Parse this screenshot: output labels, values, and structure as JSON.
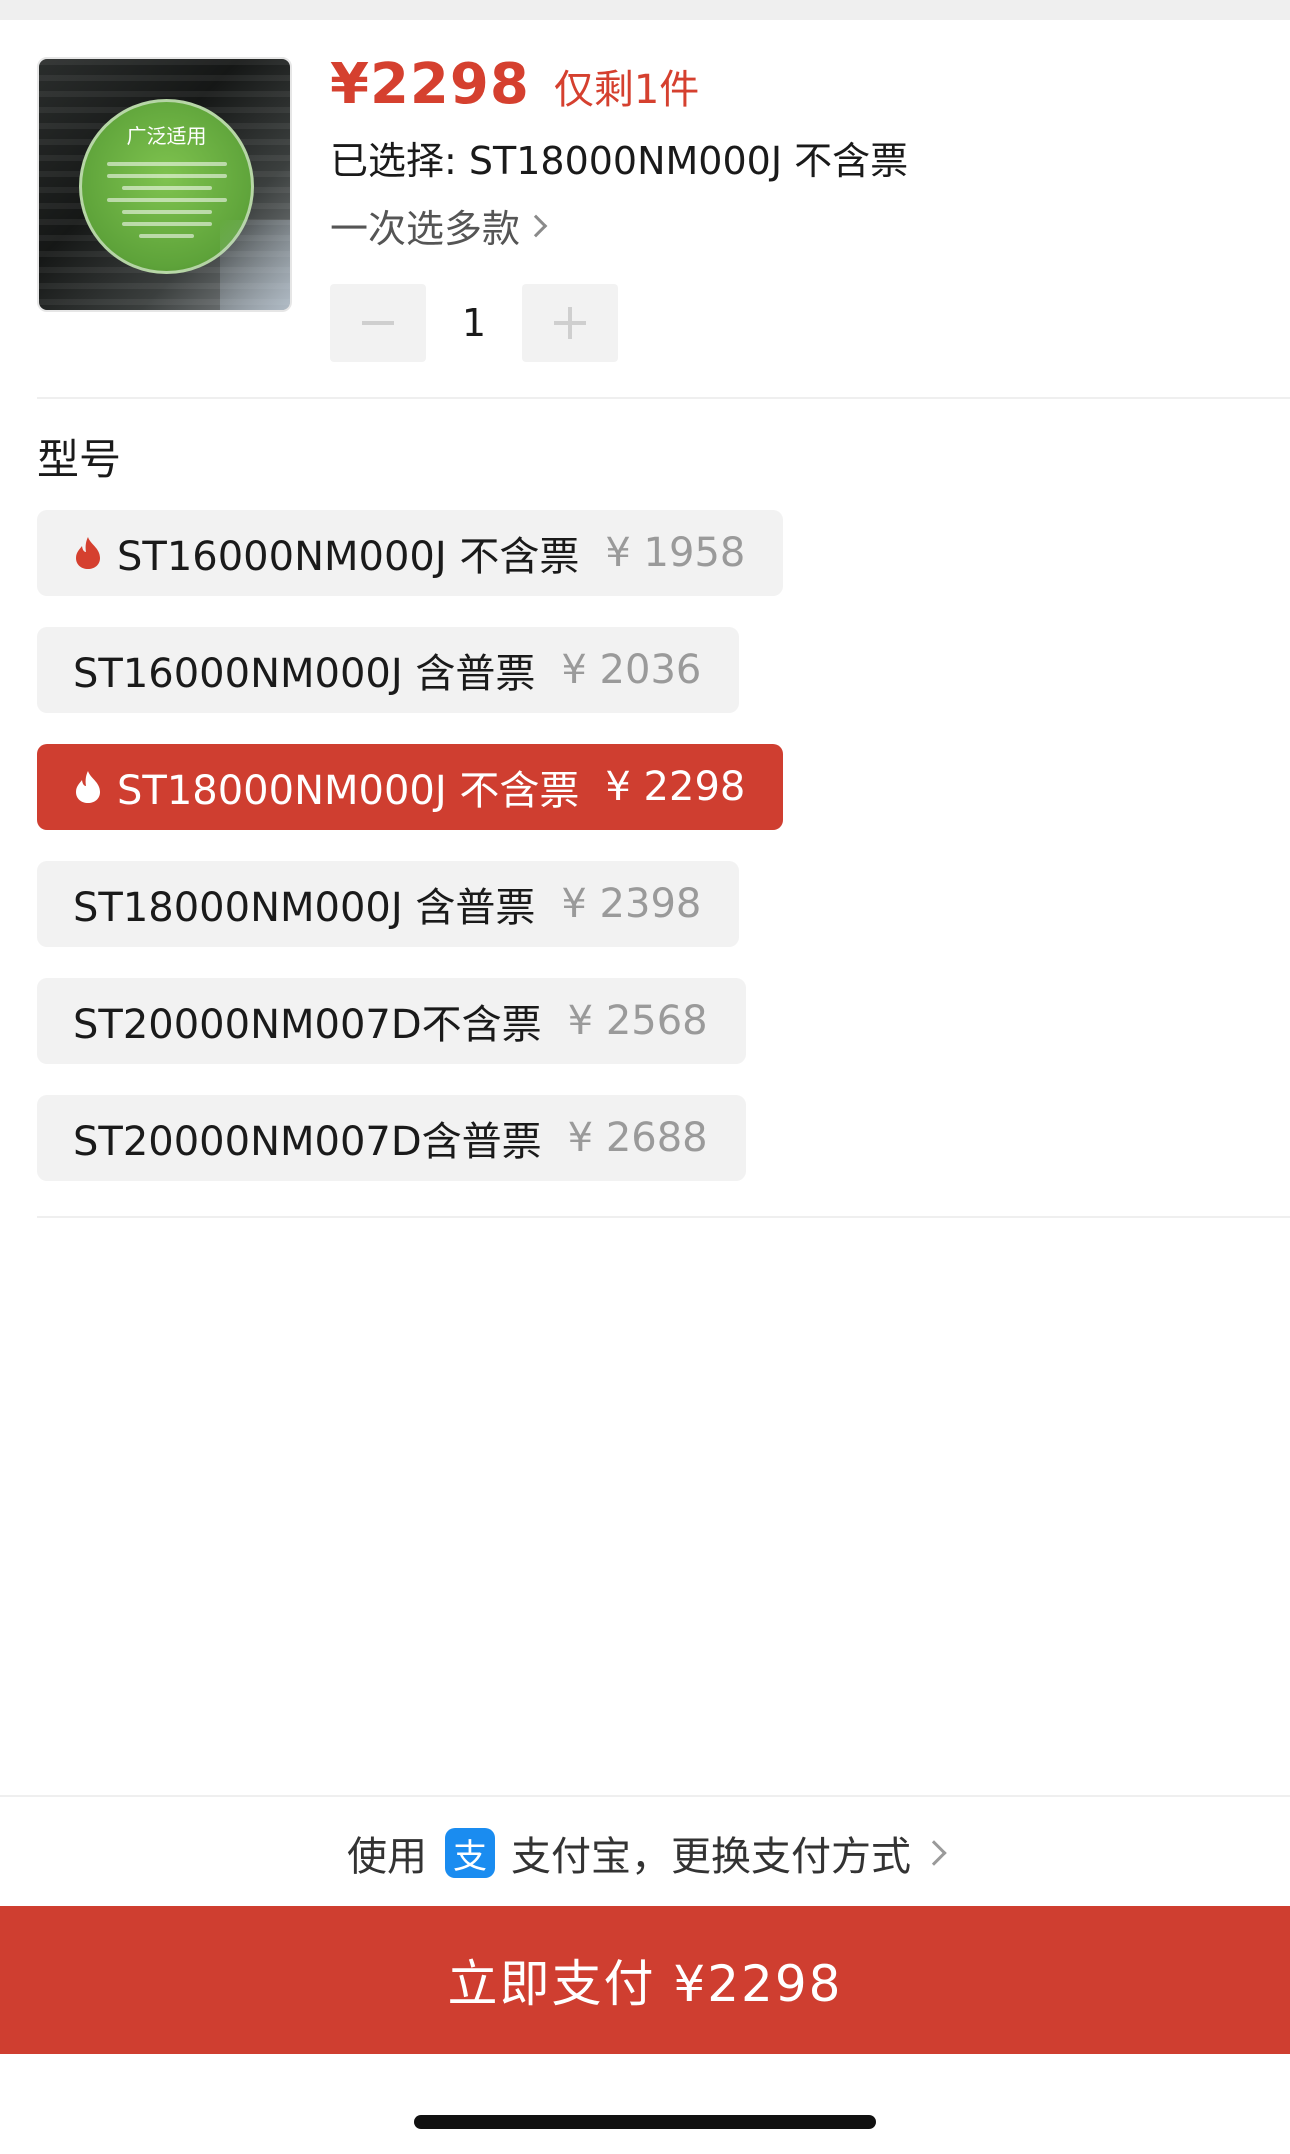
{
  "product": {
    "image_title": "广泛适用",
    "price": "¥2298",
    "stock_text": "仅剩1件",
    "selected_text": "已选择: ST18000NM000J 不含票",
    "multi_select_text": "一次选多款",
    "quantity": "1"
  },
  "options_section": {
    "title": "型号",
    "options": [
      {
        "name": "ST16000NM000J 不含票",
        "price": "¥ 1958",
        "hot": true,
        "selected": false
      },
      {
        "name": "ST16000NM000J 含普票",
        "price": "¥ 2036",
        "hot": false,
        "selected": false
      },
      {
        "name": "ST18000NM000J 不含票",
        "price": "¥ 2298",
        "hot": true,
        "selected": true
      },
      {
        "name": "ST18000NM000J 含普票",
        "price": "¥ 2398",
        "hot": false,
        "selected": false
      },
      {
        "name": "ST20000NM007D不含票",
        "price": "¥ 2568",
        "hot": false,
        "selected": false
      },
      {
        "name": "ST20000NM007D含普票",
        "price": "¥ 2688",
        "hot": false,
        "selected": false
      }
    ]
  },
  "payment": {
    "prefix": "使用",
    "icon_glyph": "支",
    "method_text": "支付宝，更换支付方式",
    "pay_button_label": "立即支付 ¥2298"
  },
  "colors": {
    "accent": "#d5402f",
    "selected_bg": "#cf3e30",
    "option_bg": "#f2f2f2",
    "alipay_blue": "#1a8cf0"
  },
  "icons": [
    "fire-icon",
    "chevron-right-icon",
    "minus-icon",
    "plus-icon",
    "alipay-icon"
  ]
}
